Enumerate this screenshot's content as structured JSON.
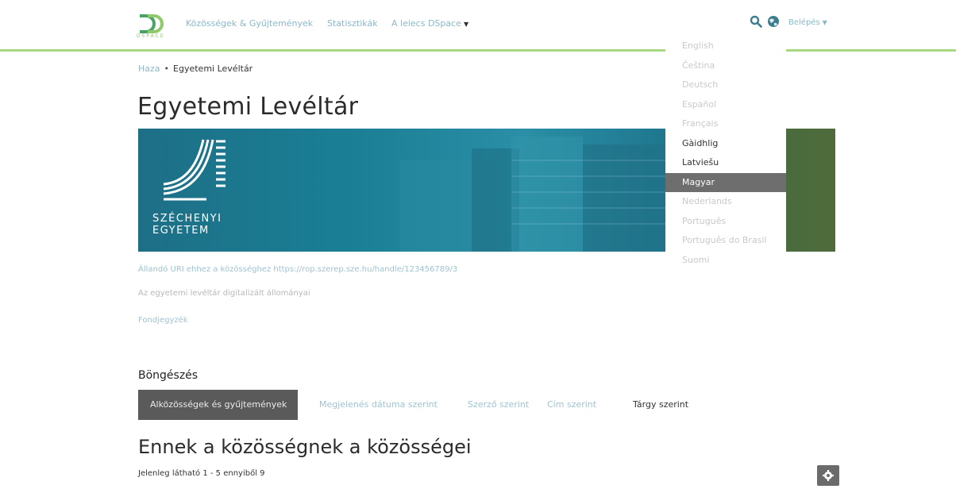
{
  "header": {
    "logo_text": "DSPACE",
    "nav": {
      "communities": "Közösségek & Gyűjtemények",
      "statistics": "Statisztikák",
      "dspace": "A leiecs DSpace"
    },
    "login": "Belépés"
  },
  "breadcrumb": {
    "home": "Haza",
    "separator": "•",
    "current": "Egyetemi Levéltár"
  },
  "page_title": "Egyetemi Levéltár",
  "banner": {
    "university_line1": "SZÉCHENYI",
    "university_line2": "EGYETEM"
  },
  "meta": {
    "uri_text": "Állandó URI ehhez a közösséghez https://rop.szerep.sze.hu/handle/123456789/3",
    "description": "Az egyetemi levéltár digitalizált állományai",
    "fonds_link": "Fondjegyzék"
  },
  "browse": {
    "heading": "Böngészés",
    "options": [
      "Alközösségek és gyűjtemények",
      "Megjelenés dátuma szerint",
      "Szerző szerint",
      "Cím szerint",
      "Tárgy szerint"
    ]
  },
  "section": {
    "title": "Ennek a közösségnek a közösségei",
    "count": "Jelenleg látható 1 - 5 ennyiből 9"
  },
  "language_menu": {
    "items": [
      "English",
      "Čeština",
      "Deutsch",
      "Español",
      "Français",
      "Gàidhlig",
      "Latviešu",
      "Magyar",
      "Nederlands",
      "Português",
      "Português do Brasil",
      "Suomi"
    ],
    "selected": "Magyar"
  },
  "colors": {
    "accent_green": "#a8d882",
    "link_blue": "#8ab8c8",
    "selected_grey": "#6e6e6e"
  }
}
